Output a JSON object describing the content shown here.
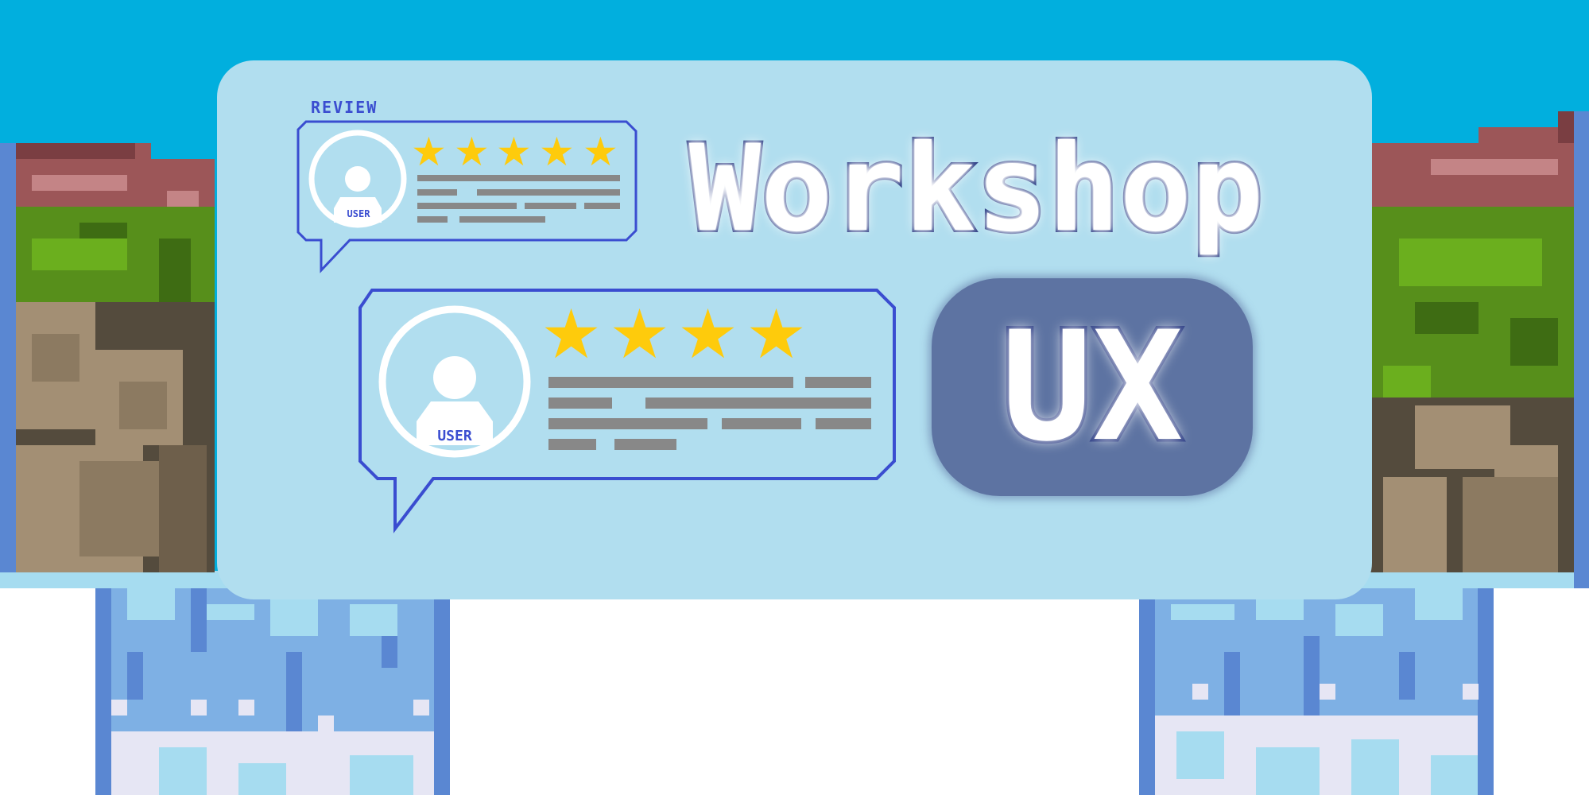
{
  "review_tag": "REVIEW",
  "title": "Workshop",
  "badge_text": "UX",
  "review_small": {
    "user_label": "USER",
    "rating": 5
  },
  "review_large": {
    "user_label": "USER",
    "rating": 4
  },
  "colors": {
    "sky": "#01afde",
    "panel": "#b1deef",
    "outline": "#3a4dd0",
    "star": "#fecb0c",
    "text_line": "#888888",
    "badge": "#5d73a2"
  }
}
